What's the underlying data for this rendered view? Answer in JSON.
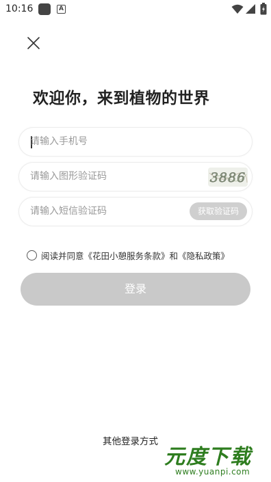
{
  "status_bar": {
    "time": "10:16",
    "icons": [
      "notification-icon",
      "a-icon",
      "wifi-icon",
      "signal-icon",
      "battery-icon"
    ]
  },
  "close_icon": "close-icon",
  "title": "欢迎你，来到植物的世界",
  "phone": {
    "placeholder": "请输入手机号",
    "value": ""
  },
  "captcha": {
    "placeholder": "请输入图形验证码",
    "value": "",
    "image_text": "3886"
  },
  "sms": {
    "placeholder": "请输入短信验证码",
    "value": "",
    "button_label": "获取验证码"
  },
  "agreement": {
    "checked": false,
    "prefix": "阅读并同意",
    "terms_link": "《花田小憩服务条款》",
    "conjunction": "和",
    "privacy_link": "《隐私政策》"
  },
  "login_label": "登录",
  "other_login_label": "其他登录方式",
  "watermark": {
    "main": "元度下载",
    "sub": "www.yuanpi.com"
  },
  "colors": {
    "button_disabled": "#c9c9c9",
    "sms_button": "#cfcfcf",
    "field_border": "#ececec",
    "watermark_green": "#2e7d1f"
  }
}
